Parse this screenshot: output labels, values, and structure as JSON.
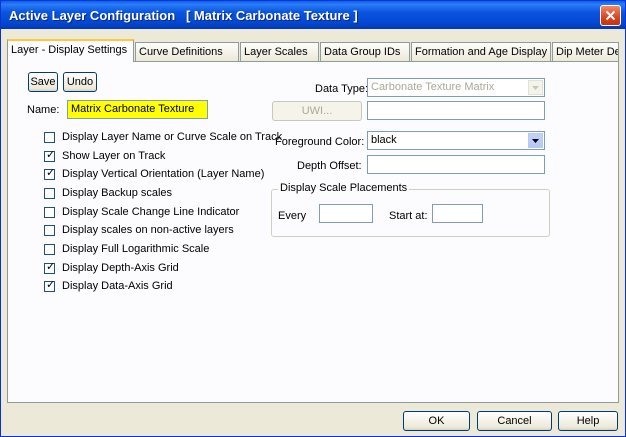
{
  "window": {
    "title": "Active Layer Configuration   [ Matrix Carbonate Texture ]"
  },
  "tabs": [
    {
      "label": "Layer - Display Settings",
      "active": true
    },
    {
      "label": "Curve Definitions"
    },
    {
      "label": "Layer Scales"
    },
    {
      "label": "Data Group IDs"
    },
    {
      "label": "Formation and Age Display"
    },
    {
      "label": "Dip Meter Definitions"
    }
  ],
  "left": {
    "save_label": "Save",
    "undo_label": "Undo",
    "name_label": "Name:",
    "name_value": "Matrix Carbonate Texture",
    "checkboxes": [
      {
        "label": "Display Layer Name or Curve Scale on Track",
        "checked": false
      },
      {
        "label": "Show Layer on Track",
        "checked": true
      },
      {
        "label": "Display Vertical Orientation (Layer Name)",
        "checked": true
      },
      {
        "label": "Display Backup scales",
        "checked": false
      },
      {
        "label": "Display Scale Change Line Indicator",
        "checked": false
      },
      {
        "label": "Display scales on non-active layers",
        "checked": false
      },
      {
        "label": "Display Full Logarithmic Scale",
        "checked": false
      },
      {
        "label": "Display Depth-Axis Grid",
        "checked": true
      },
      {
        "label": "Display Data-Axis Grid",
        "checked": true
      }
    ]
  },
  "right": {
    "data_type_label": "Data Type:",
    "data_type_value": "Carbonate Texture Matrix",
    "uwi_button_label": "UWI...",
    "uwi_value": "",
    "fg_color_label": "Foreground Color:",
    "fg_color_value": "black",
    "depth_offset_label": "Depth Offset:",
    "depth_offset_value": "",
    "scale_placements": {
      "title": "Display Scale Placements",
      "every_label": "Every",
      "every_value": "",
      "start_label": "Start at:",
      "start_value": ""
    }
  },
  "footer": {
    "ok_label": "OK",
    "cancel_label": "Cancel",
    "help_label": "Help"
  },
  "colors": {
    "titlebar": "#0a55e0",
    "name_highlight": "#ffff00",
    "tab_active_accent": "#ffc83c"
  }
}
